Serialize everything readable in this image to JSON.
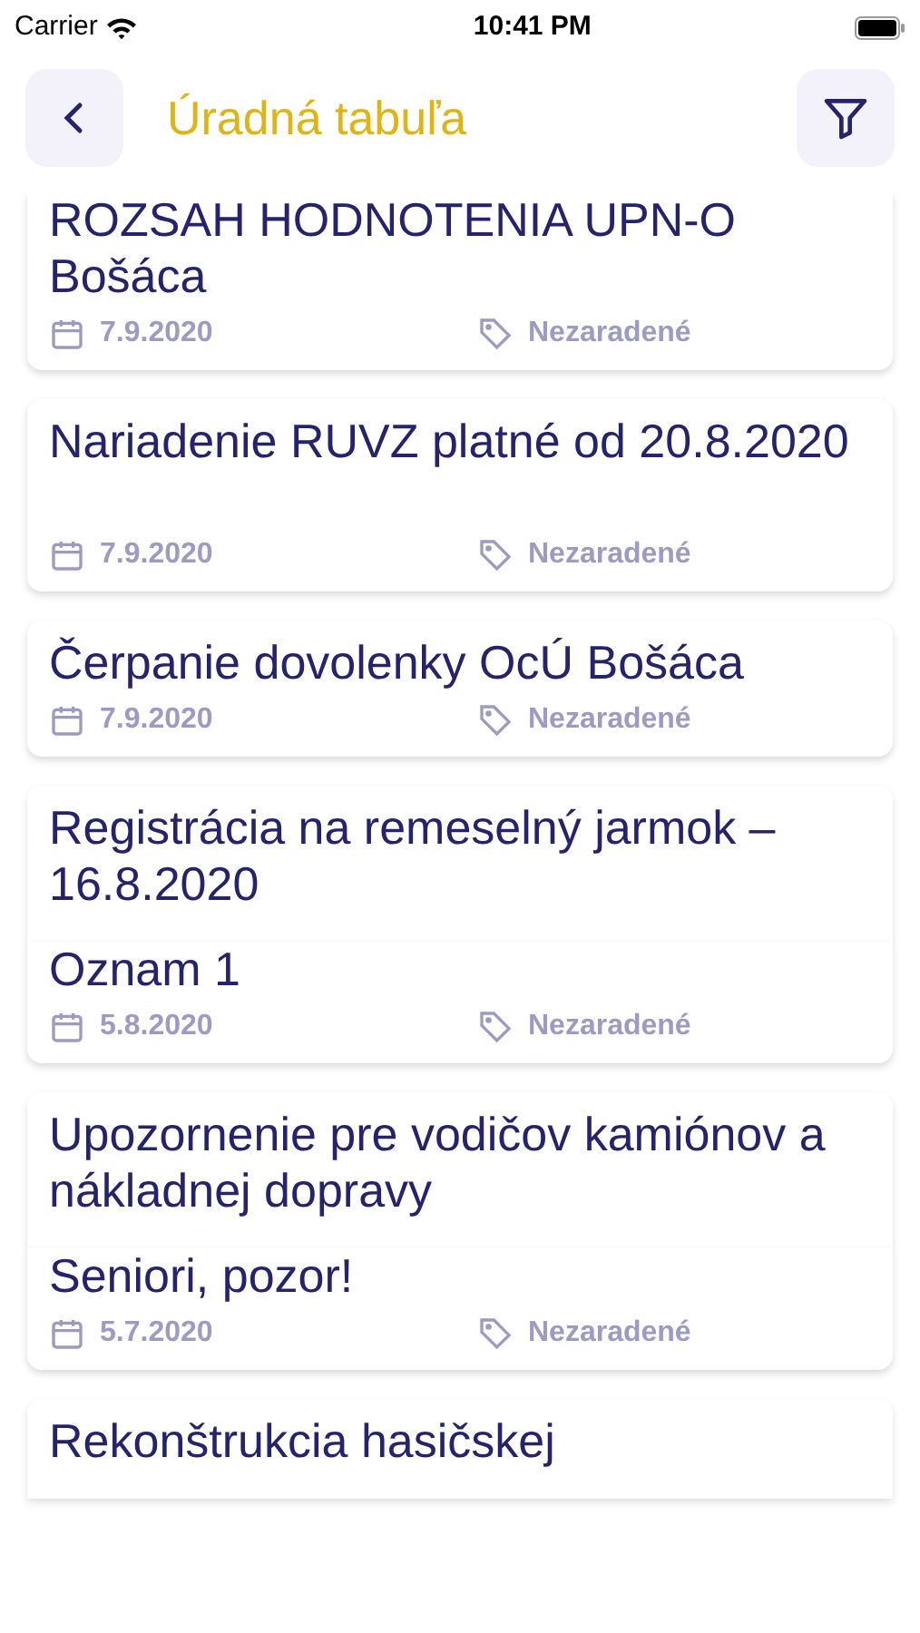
{
  "status_bar": {
    "carrier": "Carrier",
    "time": "10:41 PM"
  },
  "header": {
    "title": "Úradná tabuľa"
  },
  "items": [
    {
      "kind": "full",
      "title": "ROZSAH HODNOTENIA  UPN-O Bošáca",
      "date": "7.9.2020",
      "category": "Nezaradené"
    },
    {
      "kind": "full",
      "title": "Nariadenie RUVZ platné od 20.8.2020",
      "date": "7.9.2020",
      "category": "Nezaradené"
    },
    {
      "kind": "full",
      "title": "Čerpanie dovolenky OcÚ Bošáca",
      "date": "7.9.2020",
      "category": "Nezaradené"
    },
    {
      "kind": "covered",
      "title": "Registrácia na remeselný jarmok – 16.8.2020"
    },
    {
      "kind": "full",
      "title": "Oznam 1",
      "date": "5.8.2020",
      "category": "Nezaradené"
    },
    {
      "kind": "covered",
      "title": "Upozornenie pre vodičov kamiónov a nákladnej dopravy"
    },
    {
      "kind": "full",
      "title": "Seniori, pozor!",
      "date": "5.7.2020",
      "category": "Nezaradené"
    },
    {
      "kind": "covered",
      "title": "Rekonštrukcia hasičskej"
    }
  ]
}
